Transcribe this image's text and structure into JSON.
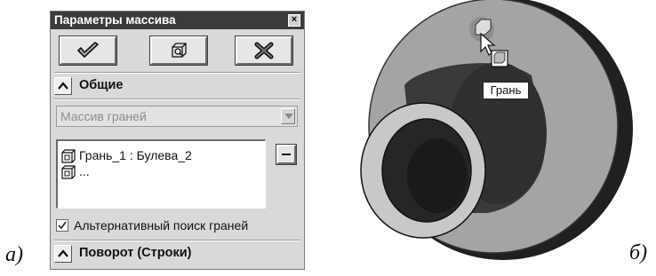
{
  "captions": {
    "left": "а)",
    "right": "б)"
  },
  "panel": {
    "title": "Параметры массива",
    "close_glyph": "×",
    "toolbar": {
      "ok_icon": "checkmark-icon",
      "preview_icon": "preview-icon",
      "cancel_icon": "cross-icon"
    },
    "section_common": {
      "title": "Общие"
    },
    "mode_select": {
      "selected": "Массив граней"
    },
    "faces_list": [
      {
        "text": "Грань_1 : Булева_2",
        "icon": "face-icon"
      },
      {
        "text": "...",
        "icon": "face-icon"
      }
    ],
    "remove_button_icon": "minus-icon",
    "alt_search": {
      "label": "Альтернативный поиск граней",
      "checked": true
    },
    "section_rotate": {
      "title": "Поворот (Строки)"
    }
  },
  "viewport": {
    "tooltip": "Грань",
    "cursor_icon": "face-select-cursor-icon"
  }
}
